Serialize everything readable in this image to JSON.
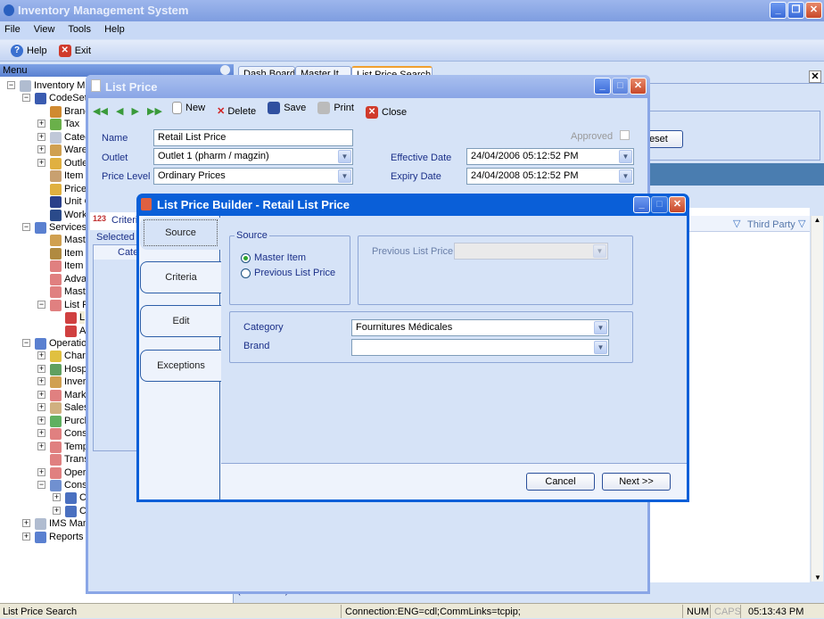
{
  "app": {
    "title": "Inventory Management System"
  },
  "menu": [
    "File",
    "View",
    "Tools",
    "Help"
  ],
  "toolbar": {
    "help_label": "Help",
    "exit_label": "Exit"
  },
  "sidebar": {
    "header": "Menu",
    "tree": [
      {
        "label": "Inventory Ma",
        "level": 0,
        "expander": "-",
        "icon": "database-icon",
        "color": "#b0bcd0"
      },
      {
        "label": "CodeSets",
        "level": 1,
        "expander": "-",
        "icon": "cubes-icon",
        "color": "#3a5bb0"
      },
      {
        "label": "Branc",
        "level": 2,
        "expander": "",
        "icon": "brand-icon",
        "color": "#d08a30"
      },
      {
        "label": "Tax",
        "level": 2,
        "expander": "+",
        "icon": "tax-icon",
        "color": "#6ab04a"
      },
      {
        "label": "Categ",
        "level": 2,
        "expander": "+",
        "icon": "category-icon",
        "color": "#c0c8d8"
      },
      {
        "label": "Ware",
        "level": 2,
        "expander": "+",
        "icon": "warehouse-icon",
        "color": "#d0a050"
      },
      {
        "label": "Outle",
        "level": 2,
        "expander": "+",
        "icon": "outlet-icon",
        "color": "#e0b040"
      },
      {
        "label": "Item T",
        "level": 2,
        "expander": "",
        "icon": "item-type-icon",
        "color": "#c8a070"
      },
      {
        "label": "Price",
        "level": 2,
        "expander": "",
        "icon": "price-icon",
        "color": "#e0b040"
      },
      {
        "label": "Unit C",
        "level": 2,
        "expander": "",
        "icon": "unit-icon",
        "color": "#2a3f8a"
      },
      {
        "label": "Work",
        "level": 2,
        "expander": "",
        "icon": "workstation-icon",
        "color": "#2a4a8a"
      },
      {
        "label": "Services",
        "level": 1,
        "expander": "-",
        "icon": "services-icon",
        "color": "#5a80d0"
      },
      {
        "label": "Maste",
        "level": 2,
        "expander": "",
        "icon": "master-icon",
        "color": "#d0a050"
      },
      {
        "label": "Item",
        "level": 2,
        "expander": "",
        "icon": "item-icon",
        "color": "#b08a40"
      },
      {
        "label": "Item I",
        "level": 2,
        "expander": "",
        "icon": "item-icon",
        "color": "#e08080"
      },
      {
        "label": "Adva",
        "level": 2,
        "expander": "",
        "icon": "advanced-icon",
        "color": "#e08080"
      },
      {
        "label": "Maste",
        "level": 2,
        "expander": "",
        "icon": "master-icon",
        "color": "#e08080"
      },
      {
        "label": "List F",
        "level": 2,
        "expander": "-",
        "icon": "list-price-icon",
        "color": "#e08080"
      },
      {
        "label": "L",
        "level": 3,
        "expander": "",
        "icon": "chart-icon",
        "color": "#d04040"
      },
      {
        "label": "A",
        "level": 3,
        "expander": "",
        "icon": "chart-icon",
        "color": "#d04040"
      },
      {
        "label": "Operation",
        "level": 1,
        "expander": "-",
        "icon": "operations-icon",
        "color": "#5a80d0"
      },
      {
        "label": "Charg",
        "level": 2,
        "expander": "+",
        "icon": "charge-icon",
        "color": "#e0c040"
      },
      {
        "label": "Hosp",
        "level": 2,
        "expander": "+",
        "icon": "hospital-icon",
        "color": "#60a060"
      },
      {
        "label": "Inver",
        "level": 2,
        "expander": "+",
        "icon": "inventory-icon",
        "color": "#d0a050"
      },
      {
        "label": "Mark",
        "level": 2,
        "expander": "+",
        "icon": "mark-icon",
        "color": "#e08080"
      },
      {
        "label": "Sales",
        "level": 2,
        "expander": "+",
        "icon": "sales-icon",
        "color": "#d0b080"
      },
      {
        "label": "Purch",
        "level": 2,
        "expander": "+",
        "icon": "purchase-icon",
        "color": "#60b060"
      },
      {
        "label": "Cons",
        "level": 2,
        "expander": "+",
        "icon": "consumption-icon",
        "color": "#e08080"
      },
      {
        "label": "Temp",
        "level": 2,
        "expander": "+",
        "icon": "temp-icon",
        "color": "#e08080"
      },
      {
        "label": "Trans",
        "level": 2,
        "expander": "",
        "icon": "transfer-icon",
        "color": "#e08080"
      },
      {
        "label": "Oper",
        "level": 2,
        "expander": "+",
        "icon": "operation-icon",
        "color": "#e08080"
      },
      {
        "label": "Cons",
        "level": 2,
        "expander": "-",
        "icon": "consignment-icon",
        "color": "#7090d0"
      },
      {
        "label": "Consignee",
        "level": 3,
        "expander": "+",
        "icon": "consignee-icon",
        "color": "#4a70c0"
      },
      {
        "label": "Consignor",
        "level": 3,
        "expander": "+",
        "icon": "consignor-icon",
        "color": "#4a70c0"
      },
      {
        "label": "IMS Management",
        "level": 1,
        "expander": "+",
        "icon": "ims-icon",
        "color": "#b0bcd0"
      },
      {
        "label": "Reports",
        "level": 1,
        "expander": "+",
        "icon": "reports-icon",
        "color": "#5a80d0"
      }
    ]
  },
  "main": {
    "tabs": [
      "Dash Board",
      "Master It",
      "List Price Search"
    ],
    "reset_label": "Reset",
    "column_third_party": "Third Party",
    "records": "(0 Records)"
  },
  "list_price": {
    "title": "List Price",
    "toolbar": {
      "new": "New",
      "delete": "Delete",
      "save": "Save",
      "print": "Print",
      "close": "Close"
    },
    "name_label": "Name",
    "name_value": "Retail List Price",
    "outlet_label": "Outlet",
    "outlet_value": "Outlet 1 (pharm / magzin)",
    "price_level_label": "Price Level",
    "price_level_value": "Ordinary Prices",
    "approved_label": "Approved",
    "approved": false,
    "effective_label": "Effective Date",
    "effective_value": "24/04/2006 05:12:52 PM",
    "expiry_label": "Expiry Date",
    "expiry_value": "24/04/2008 05:12:52 PM",
    "criteria_tab": "Criteria",
    "selected_label": "Selected C",
    "category_col": "Categ"
  },
  "builder": {
    "title": "List Price Builder - Retail List Price",
    "side_tabs": [
      "Source",
      "Criteria",
      "Edit",
      "Exceptions"
    ],
    "active_tab": "Source",
    "source_group": "Source",
    "options": [
      "Master Item",
      "Previous List Price"
    ],
    "selected_option": "Master Item",
    "previous_label": "Previous List Price",
    "previous_value": "",
    "category_label": "Category",
    "category_value": "Fournitures Médicales",
    "brand_label": "Brand",
    "brand_value": "",
    "cancel": "Cancel",
    "next": "Next >>"
  },
  "status": {
    "left": "List Price Search",
    "connection": "Connection:ENG=cdl;CommLinks=tcpip;",
    "num": "NUM",
    "caps": "CAPS",
    "time": "05:13:43 PM"
  }
}
